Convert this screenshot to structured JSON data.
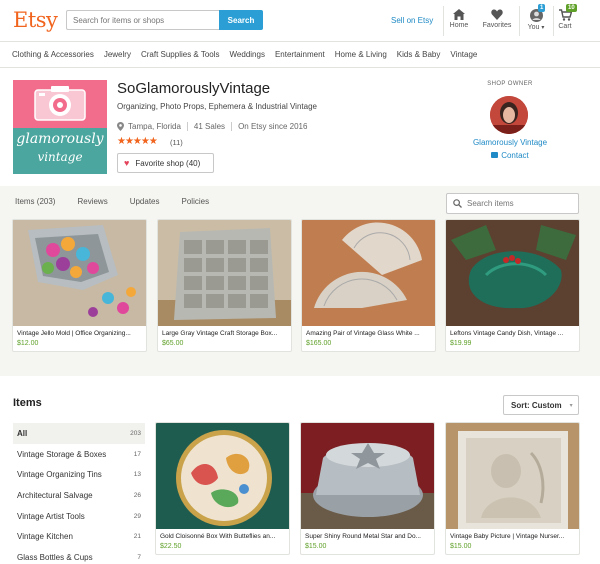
{
  "header": {
    "logo": "Etsy",
    "search_placeholder": "Search for items or shops",
    "search_button": "Search",
    "sell_link": "Sell on Etsy",
    "home_label": "Home",
    "favorites_label": "Favorites",
    "you_label": "You",
    "you_caret": "▾",
    "cart_label": "Cart",
    "notif_badge": "1",
    "cart_badge": "10",
    "colors": {
      "brand": "#f1641e",
      "search_button": "#2b9fd5",
      "notif_badge": "#2b9fd5",
      "cart_badge": "#5fa028"
    }
  },
  "categories": [
    "Clothing & Accessories",
    "Jewelry",
    "Craft Supplies & Tools",
    "Weddings",
    "Entertainment",
    "Home & Living",
    "Kids & Baby",
    "Vintage"
  ],
  "shop": {
    "banner_top_text": "glamorously",
    "banner_bottom_text": "vintage",
    "name": "SoGlamorouslyVintage",
    "tagline": "Organizing, Photo Props, Ephemera & Industrial Vintage",
    "location": "Tampa, Florida",
    "sales": "41 Sales",
    "since": "On Etsy since 2016",
    "stars": "★★★★★",
    "review_count": "(11)",
    "favorite_label": "Favorite shop (40)"
  },
  "owner": {
    "title": "SHOP OWNER",
    "name": "Glamorously Vintage",
    "contact": "Contact"
  },
  "tabs": [
    "Items (203)",
    "Reviews",
    "Updates",
    "Policies"
  ],
  "shop_search_placeholder": "Search items",
  "featured": [
    {
      "title": "Vintage Jello Mold | Office Organizing...",
      "price": "$12.00"
    },
    {
      "title": "Large Gray Vintage Craft Storage Box...",
      "price": "$65.00"
    },
    {
      "title": "Amazing Pair of Vintage Glass White ...",
      "price": "$165.00"
    },
    {
      "title": "Leftons Vintage Candy Dish, Vintage ...",
      "price": "$19.99"
    }
  ],
  "items": {
    "heading": "Items",
    "sort_label": "Sort: Custom",
    "sort_caret": "▾",
    "sections": [
      {
        "label": "All",
        "count": "203"
      },
      {
        "label": "Vintage Storage & Boxes",
        "count": "17"
      },
      {
        "label": "Vintage Organizing Tins",
        "count": "13"
      },
      {
        "label": "Architectural Salvage",
        "count": "26"
      },
      {
        "label": "Vintage Artist Tools",
        "count": "29"
      },
      {
        "label": "Vintage Kitchen",
        "count": "21"
      },
      {
        "label": "Glass Bottles & Cups",
        "count": "7"
      }
    ],
    "listings": [
      {
        "title": "Gold Cloisonné Box With Butteflies an...",
        "price": "$22.50"
      },
      {
        "title": "Super Shiny Round Metal Star and Do...",
        "price": "$15.00"
      },
      {
        "title": "Vintage Baby Picture | Vintage Nurser...",
        "price": "$15.00"
      }
    ]
  }
}
